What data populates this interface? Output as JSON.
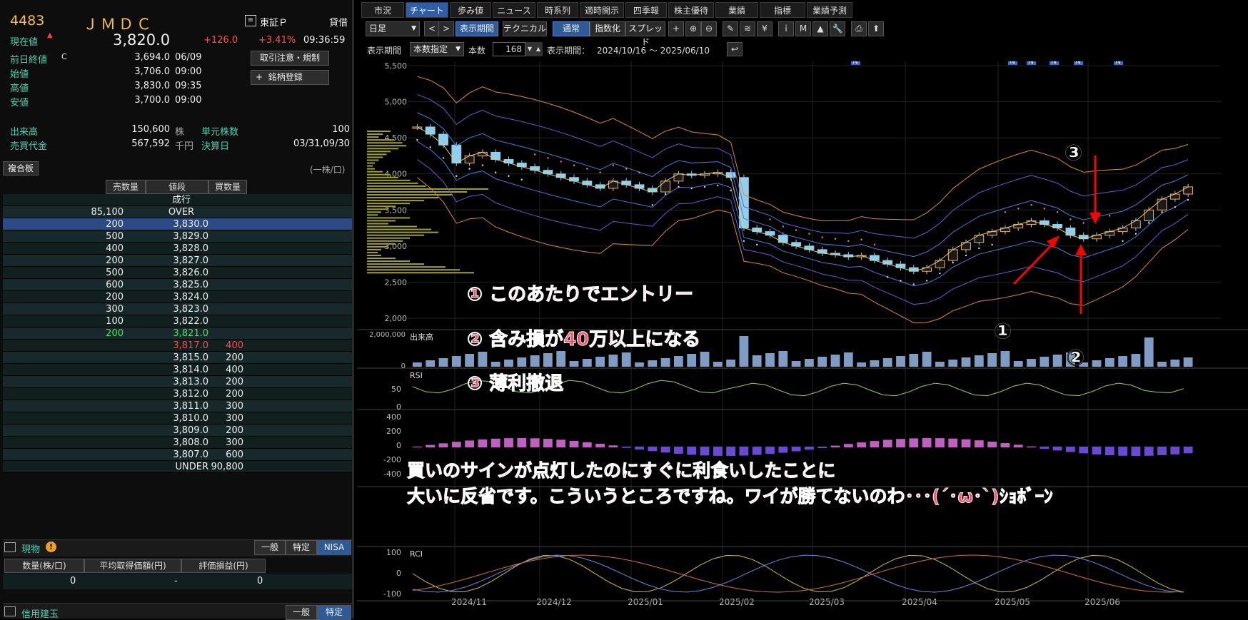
{
  "stock": {
    "code": "4483",
    "name": "ＪＭＤＣ",
    "market": "東証Ｐ",
    "margin": "貸借",
    "price_label": "現在値",
    "price_mark": "▲",
    "price": "3,820.0",
    "change": "+126.0",
    "change_pct": "+3.41%",
    "time": "09:36:59"
  },
  "quote": [
    {
      "label": "前日終値",
      "flag": "C",
      "value": "3,694.0",
      "time": "06/09"
    },
    {
      "label": "始値",
      "flag": "",
      "value": "3,706.0",
      "time": "09:00"
    },
    {
      "label": "高値",
      "flag": "",
      "value": "3,830.0",
      "time": "09:35"
    },
    {
      "label": "安値",
      "flag": "",
      "value": "3,700.0",
      "time": "09:00"
    }
  ],
  "buttons": {
    "notice": "取引注意・規制",
    "register": "銘柄登録",
    "plus": "+"
  },
  "stats": {
    "vol_label": "出来高",
    "vol": "150,600",
    "vol_unit": "株",
    "unit_label": "単元株数",
    "unit": "100",
    "amt_label": "売買代金",
    "amt": "567,592",
    "amt_unit": "千円",
    "settle_label": "決算日",
    "settle": "03/31,09/30"
  },
  "board": {
    "title": "複合板",
    "unit": "(一株/口)",
    "h_sell": "売数量",
    "h_price": "値段",
    "h_buy": "買数量",
    "rows": [
      {
        "sell": "",
        "price": "成行",
        "buy": "",
        "cls": "w"
      },
      {
        "sell": "85,100",
        "price": "OVER",
        "buy": "",
        "cls": "w"
      },
      {
        "sell": "200",
        "price": "3,830.0",
        "buy": "",
        "cls": "sel"
      },
      {
        "sell": "500",
        "price": "3,829.0",
        "buy": "",
        "cls": "w"
      },
      {
        "sell": "400",
        "price": "3,828.0",
        "buy": "",
        "cls": "w"
      },
      {
        "sell": "200",
        "price": "3,827.0",
        "buy": "",
        "cls": "w"
      },
      {
        "sell": "500",
        "price": "3,826.0",
        "buy": "",
        "cls": "w"
      },
      {
        "sell": "600",
        "price": "3,825.0",
        "buy": "",
        "cls": "w"
      },
      {
        "sell": "200",
        "price": "3,824.0",
        "buy": "",
        "cls": "w"
      },
      {
        "sell": "300",
        "price": "3,823.0",
        "buy": "",
        "cls": "w"
      },
      {
        "sell": "100",
        "price": "3,822.0",
        "buy": "",
        "cls": "w"
      },
      {
        "sell": "200",
        "price": "3,821.0",
        "buy": "",
        "cls": "g"
      },
      {
        "sell": "",
        "price": "3,817.0",
        "buy": "400",
        "cls": "r"
      },
      {
        "sell": "",
        "price": "3,815.0",
        "buy": "200",
        "cls": "w"
      },
      {
        "sell": "",
        "price": "3,814.0",
        "buy": "400",
        "cls": "w"
      },
      {
        "sell": "",
        "price": "3,813.0",
        "buy": "200",
        "cls": "w"
      },
      {
        "sell": "",
        "price": "3,812.0",
        "buy": "200",
        "cls": "w"
      },
      {
        "sell": "",
        "price": "3,811.0",
        "buy": "300",
        "cls": "w"
      },
      {
        "sell": "",
        "price": "3,810.0",
        "buy": "300",
        "cls": "w"
      },
      {
        "sell": "",
        "price": "3,809.0",
        "buy": "200",
        "cls": "w"
      },
      {
        "sell": "",
        "price": "3,808.0",
        "buy": "300",
        "cls": "w"
      },
      {
        "sell": "",
        "price": "3,807.0",
        "buy": "600",
        "cls": "w"
      },
      {
        "sell": "",
        "price": "UNDER",
        "buy": "90,800",
        "cls": "w"
      }
    ]
  },
  "holdings": {
    "title": "現物",
    "warn": "!",
    "tabs": [
      "一般",
      "特定",
      "NISA"
    ],
    "cols": [
      "数量(株/口)",
      "平均取得価額(円)",
      "評価損益(円)"
    ],
    "vals": [
      "0",
      "-",
      "0"
    ]
  },
  "credit": {
    "title": "信用建玉",
    "tabs": [
      "一般",
      "特定"
    ]
  },
  "chart_tabs": [
    "市況",
    "チャート",
    "歩み値",
    "ニュース",
    "時系列",
    "適時開示",
    "四季報",
    "株主優待",
    "業績",
    "指標",
    "業績予測"
  ],
  "toolbar": {
    "period": "日足",
    "prev": "<",
    "next": ">",
    "show_period": "表示期間",
    "technical": "テクニカル",
    "normal": "通常",
    "index": "指数化",
    "spread": "スプレッド",
    "icons": [
      "+",
      "⊕",
      "⊖",
      "✎",
      "≋",
      "¥",
      "i",
      "M",
      "▲",
      "🔧",
      "⎙",
      "⬆"
    ]
  },
  "toolbar2": {
    "label": "表示期間",
    "mode": "本数指定",
    "count_label": "本数",
    "count": "168",
    "range_label": "表示期間：",
    "range": "2024/10/16 ～ 2025/06/10"
  },
  "news_marker": "N",
  "panels": {
    "volume": "出来高",
    "rsi": "RSI",
    "rci": "RCI"
  },
  "annotations": {
    "a1": "① このあたりでエントリー",
    "a2": "② 含み損が40万以上になる",
    "a3": "③ 薄利撤退",
    "c1": "①",
    "c2": "②",
    "c3": "③",
    "cm1": "買いのサインが点灯したのにすぐに利食いしたことに",
    "cm2": "大いに反省です。こういうところですね。ワイが勝てないのわ･･･(´･ω･`)ｼｮﾎﾞｰﾝ"
  },
  "chart_data": {
    "type": "candlestick",
    "x_ticks": [
      "2024/11",
      "2024/12",
      "2025/01",
      "2025/02",
      "2025/03",
      "2025/04",
      "2025/05",
      "2025/06"
    ],
    "price_ticks": [
      "5,500",
      "5,000",
      "4,500",
      "4,000",
      "3,500",
      "3,000",
      "2,500",
      "2,000"
    ],
    "price_ylim": [
      2000,
      5500
    ],
    "volume_ticks": [
      "2,000,000",
      "0"
    ],
    "rsi_ticks": [
      "50",
      "0"
    ],
    "macd_ticks": [
      "400",
      "200",
      "0",
      "-200",
      "-400"
    ],
    "rci_ticks": [
      "100",
      "0",
      "-100"
    ],
    "close_approx": [
      4650,
      4550,
      4400,
      4150,
      4250,
      4300,
      4200,
      4150,
      4100,
      4050,
      4000,
      3950,
      3900,
      3850,
      3800,
      3900,
      3850,
      3800,
      3750,
      3900,
      4000,
      3980,
      4000,
      4020,
      3950,
      3250,
      3200,
      3150,
      3050,
      3000,
      2950,
      2900,
      2880,
      2850,
      2870,
      2800,
      2750,
      2700,
      2650,
      2700,
      2800,
      2950,
      3050,
      3150,
      3200,
      3250,
      3300,
      3350,
      3300,
      3250,
      3150,
      3100,
      3150,
      3200,
      3250,
      3350,
      3500,
      3650,
      3720,
      3820
    ]
  }
}
